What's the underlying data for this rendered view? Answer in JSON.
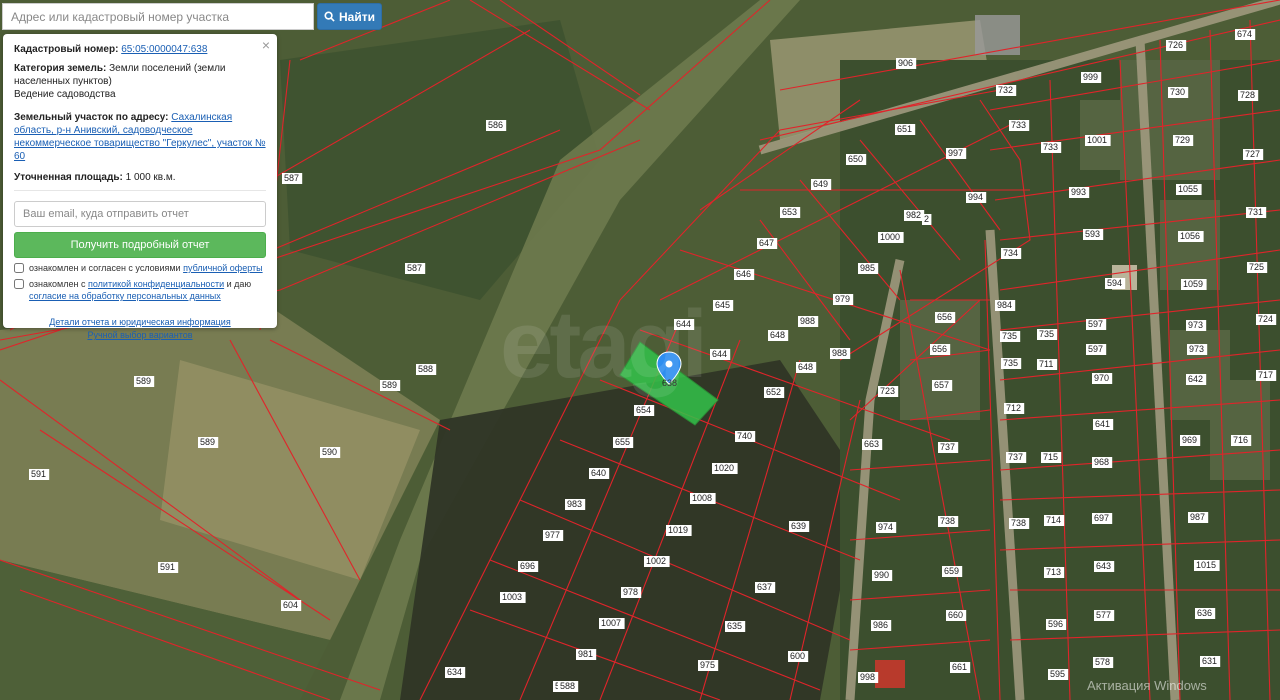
{
  "search": {
    "placeholder": "Адрес или кадастровый номер участка",
    "button_label": "Найти"
  },
  "panel": {
    "cadastral_label": "Кадастровый номер:",
    "cadastral_value": "65:05:0000047:638",
    "category_label": "Категория земель:",
    "category_value": "Земли поселений (земли населенных пунктов)",
    "usage": "Ведение садоводства",
    "address_label": "Земельный участок по адресу:",
    "address_value": "Сахалинская область, р-н Анивский, садоводческое некоммерческое товарищество \"Геркулес\", участок № 60",
    "area_label": "Уточненная площадь:",
    "area_value": "1 000 кв.м.",
    "email_placeholder": "Ваш email, куда отправить отчет",
    "report_button": "Получить подробный отчет",
    "check1_text": "ознакомлен и согласен с условиями",
    "check1_link": "публичной оферты",
    "check2_text": "ознакомлен с",
    "check2_link1": "политикой конфиденциальности",
    "check2_mid": "и даю",
    "check2_link2": "согласие на обработку персональных данных",
    "details_link": "Детали отчета и юридическая информация",
    "manual_link": "Ручной выбор вариантов",
    "close_symbol": "×"
  },
  "map": {
    "selected_plot": "638",
    "watermark_logo": "etagi",
    "windows_watermark": "Активация Windows",
    "plot_labels": [
      "906",
      "726",
      "674",
      "999",
      "730",
      "728",
      "732",
      "733",
      "733",
      "651",
      "650",
      "997",
      "1001",
      "729",
      "727",
      "649",
      "653",
      "993",
      "982",
      "2",
      "994",
      "1055",
      "731",
      "647",
      "1000",
      "1056",
      "646",
      "985",
      "734",
      "593",
      "725",
      "645",
      "979",
      "594",
      "1059",
      "644",
      "648",
      "988",
      "656",
      "984",
      "597",
      "973",
      "724",
      "644",
      "988",
      "656",
      "735",
      "735",
      "597",
      "973",
      "652",
      "648",
      "657",
      "735",
      "711",
      "970",
      "642",
      "654",
      "723",
      "717",
      "740",
      "712",
      "641",
      "655",
      "663",
      "737",
      "737",
      "715",
      "968",
      "969",
      "716",
      "1020",
      "640",
      "1008",
      "983",
      "974",
      "738",
      "738",
      "714",
      "697",
      "987",
      "639",
      "1019",
      "977",
      "990",
      "659",
      "713",
      "643",
      "1002",
      "696",
      "1015",
      "637",
      "978",
      "1003",
      "986",
      "660",
      "596",
      "577",
      "636",
      "1007",
      "635",
      "981",
      "600",
      "975",
      "998",
      "661",
      "595",
      "578",
      "631",
      "634",
      "585",
      "586",
      "587",
      "587",
      "588",
      "589",
      "589",
      "590",
      "591",
      "591",
      "604",
      "589",
      "588"
    ]
  }
}
